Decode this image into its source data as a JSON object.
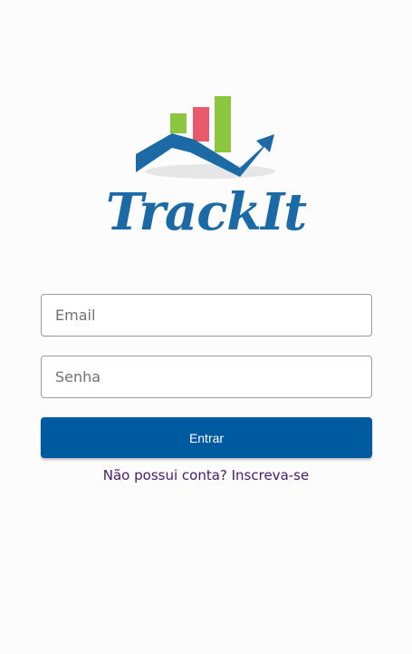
{
  "logo": {
    "text": "TrackIt",
    "colors": {
      "blue": "#1b6aa5",
      "green": "#8cc63f",
      "red": "#e85a6b",
      "shadow": "#e6e6e6"
    }
  },
  "form": {
    "email_placeholder": "Email",
    "password_placeholder": "Senha",
    "submit_label": "Entrar",
    "signup_link": "Não possui conta? Inscreva-se",
    "button_color": "#005aa0",
    "link_color": "#4a1a6b"
  }
}
